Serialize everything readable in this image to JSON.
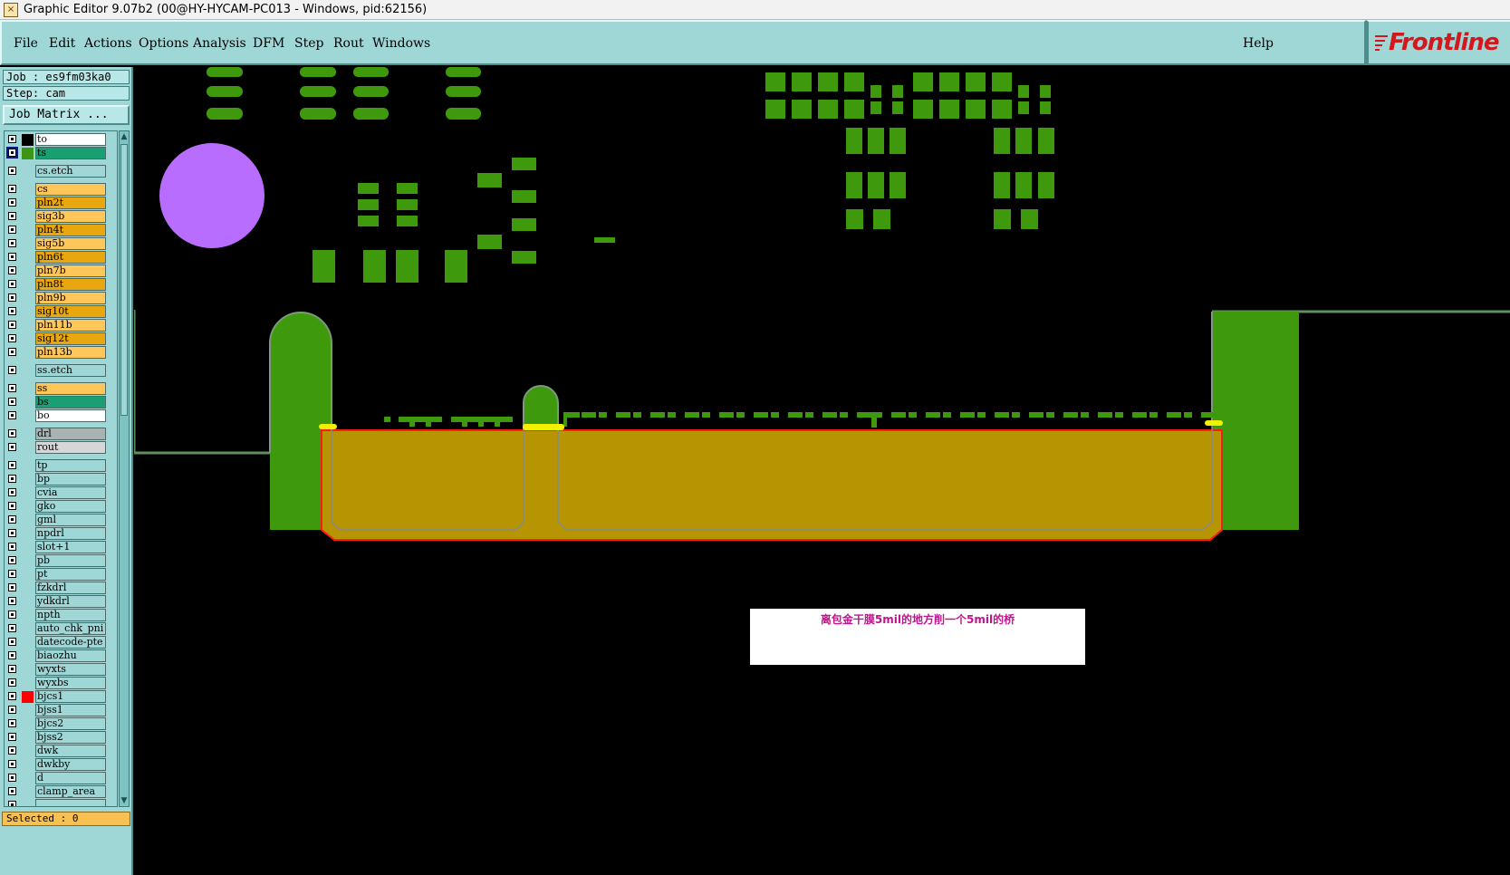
{
  "window": {
    "title": "Graphic Editor 9.07b2 (00@HY-HYCAM-PC013 - Windows, pid:62156)"
  },
  "menu": {
    "items": [
      "File",
      "Edit",
      "Actions",
      "Options",
      "Analysis",
      "DFM",
      "Step",
      "Rout",
      "Windows"
    ],
    "help": "Help",
    "logo": "Frontline"
  },
  "job": {
    "job_label": "Job : es9fm03ka0",
    "step_label": "Step: cam",
    "matrix_button": "Job Matrix ..."
  },
  "layers": [
    {
      "name": "to",
      "bg": "#ffffff",
      "swatch": "#000000"
    },
    {
      "name": "ts",
      "bg": "#1a9f72",
      "swatch": "#3c9613",
      "active": true
    },
    {
      "name": "cs.etch",
      "bg": "#9fd6d6",
      "swatch": ""
    },
    {
      "name": "cs",
      "bg": "#ffc65a",
      "swatch": ""
    },
    {
      "name": "pln2t",
      "bg": "#e8a60f",
      "swatch": ""
    },
    {
      "name": "sig3b",
      "bg": "#ffc65a",
      "swatch": ""
    },
    {
      "name": "pln4t",
      "bg": "#e8a60f",
      "swatch": ""
    },
    {
      "name": "sig5b",
      "bg": "#ffc65a",
      "swatch": ""
    },
    {
      "name": "pln6t",
      "bg": "#e8a60f",
      "swatch": ""
    },
    {
      "name": "pln7b",
      "bg": "#ffc65a",
      "swatch": ""
    },
    {
      "name": "pln8t",
      "bg": "#e8a60f",
      "swatch": ""
    },
    {
      "name": "pln9b",
      "bg": "#ffc65a",
      "swatch": ""
    },
    {
      "name": "sig10t",
      "bg": "#e8a60f",
      "swatch": ""
    },
    {
      "name": "pln11b",
      "bg": "#ffc65a",
      "swatch": ""
    },
    {
      "name": "sig12t",
      "bg": "#e8a60f",
      "swatch": ""
    },
    {
      "name": "pln13b",
      "bg": "#ffc65a",
      "swatch": ""
    },
    {
      "name": "ss.etch",
      "bg": "#9fd6d6",
      "swatch": ""
    },
    {
      "name": "ss",
      "bg": "#ffc65a",
      "swatch": ""
    },
    {
      "name": "bs",
      "bg": "#1a9f72",
      "swatch": ""
    },
    {
      "name": "bo",
      "bg": "#ffffff",
      "swatch": ""
    },
    {
      "name": "drl",
      "bg": "#a8b4b4",
      "swatch": ""
    },
    {
      "name": "rout",
      "bg": "#d6d6d6",
      "swatch": ""
    },
    {
      "name": "tp",
      "bg": "#9fd6d6",
      "swatch": ""
    },
    {
      "name": "bp",
      "bg": "#9fd6d6",
      "swatch": ""
    },
    {
      "name": "cvia",
      "bg": "#9fd6d6",
      "swatch": ""
    },
    {
      "name": "gko",
      "bg": "#9fd6d6",
      "swatch": ""
    },
    {
      "name": "gml",
      "bg": "#9fd6d6",
      "swatch": ""
    },
    {
      "name": "npdrl",
      "bg": "#9fd6d6",
      "swatch": ""
    },
    {
      "name": "slot+1",
      "bg": "#9fd6d6",
      "swatch": ""
    },
    {
      "name": "pb",
      "bg": "#9fd6d6",
      "swatch": ""
    },
    {
      "name": "pt",
      "bg": "#9fd6d6",
      "swatch": ""
    },
    {
      "name": "fzkdrl",
      "bg": "#9fd6d6",
      "swatch": ""
    },
    {
      "name": "ydkdrl",
      "bg": "#9fd6d6",
      "swatch": ""
    },
    {
      "name": "npth",
      "bg": "#9fd6d6",
      "swatch": ""
    },
    {
      "name": "auto_chk_pni",
      "bg": "#9fd6d6",
      "swatch": ""
    },
    {
      "name": "datecode-pte",
      "bg": "#9fd6d6",
      "swatch": ""
    },
    {
      "name": "biaozhu",
      "bg": "#9fd6d6",
      "swatch": ""
    },
    {
      "name": "wyxts",
      "bg": "#9fd6d6",
      "swatch": ""
    },
    {
      "name": "wyxbs",
      "bg": "#9fd6d6",
      "swatch": ""
    },
    {
      "name": "bjcs1",
      "bg": "#9fd6d6",
      "swatch": "#ff0000"
    },
    {
      "name": "bjss1",
      "bg": "#9fd6d6",
      "swatch": ""
    },
    {
      "name": "bjcs2",
      "bg": "#9fd6d6",
      "swatch": ""
    },
    {
      "name": "bjss2",
      "bg": "#9fd6d6",
      "swatch": ""
    },
    {
      "name": "dwk",
      "bg": "#9fd6d6",
      "swatch": ""
    },
    {
      "name": "dwkby",
      "bg": "#9fd6d6",
      "swatch": ""
    },
    {
      "name": "d",
      "bg": "#9fd6d6",
      "swatch": ""
    },
    {
      "name": "clamp_area",
      "bg": "#9fd6d6",
      "swatch": ""
    },
    {
      "name": "",
      "bg": "#9fd6d6",
      "swatch": ""
    }
  ],
  "status": {
    "selected": "Selected : 0"
  },
  "annotation": {
    "text": "离包金干膜5mil的地方削一个5mil的桥"
  },
  "colors": {
    "feature_green": "#3e9a0c",
    "board_gold": "#b69402",
    "outline_red": "#ff1a1a",
    "highlight_yellow": "#f0f000",
    "pad_violet": "#b96dff",
    "ui_teal": "#9fd6d6"
  }
}
